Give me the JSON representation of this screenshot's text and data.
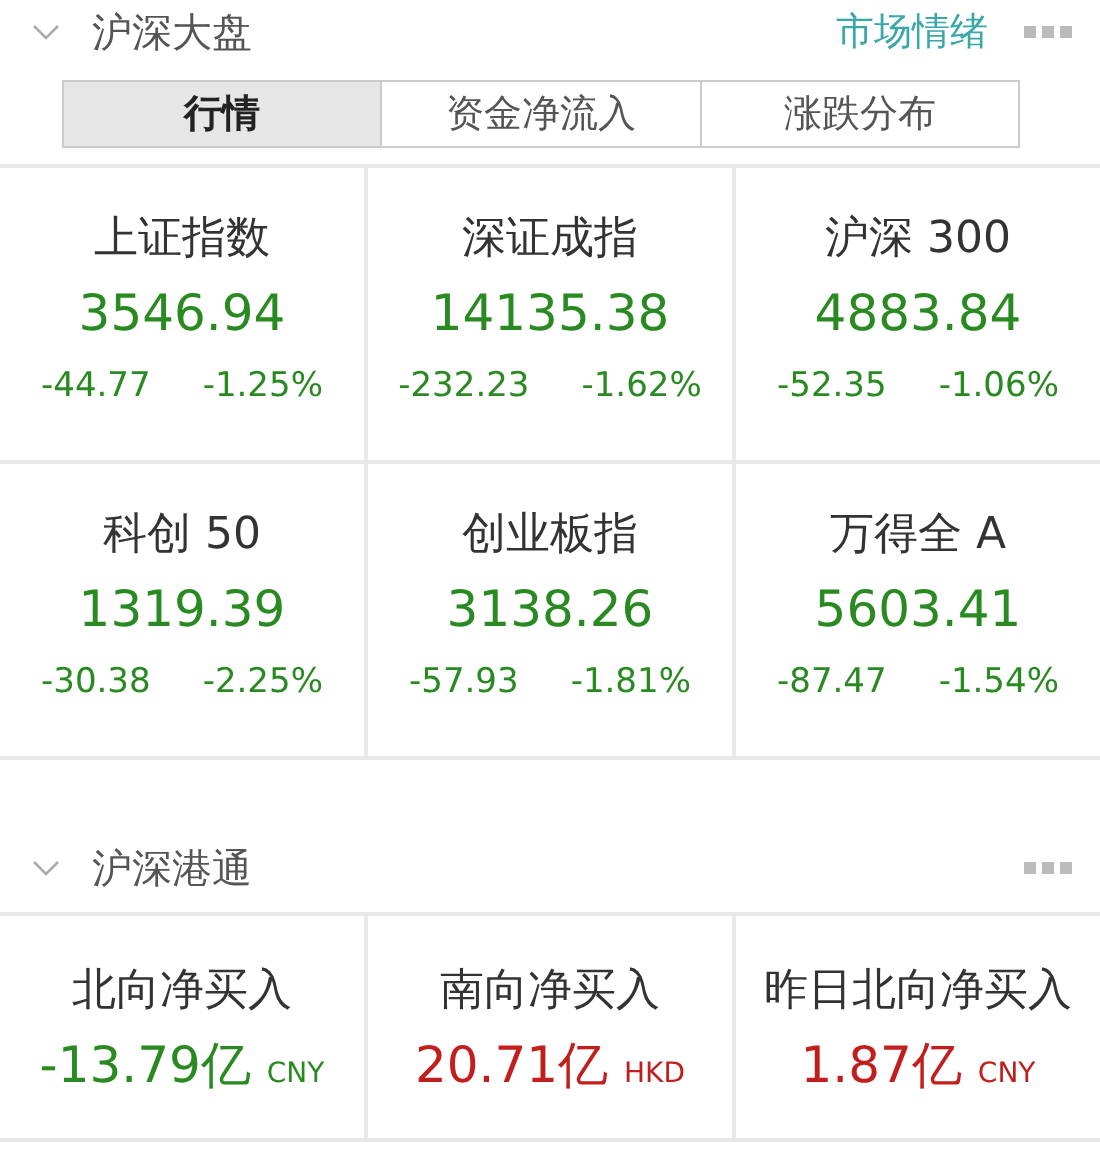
{
  "market": {
    "title": "沪深大盘",
    "link": "市场情绪",
    "tabs": [
      {
        "label": "行情",
        "selected": true
      },
      {
        "label": "资金净流入",
        "selected": false
      },
      {
        "label": "涨跌分布",
        "selected": false
      }
    ],
    "indices": [
      {
        "name": "上证指数",
        "value": "3546.94",
        "change": "-44.77",
        "percent": "-1.25%",
        "color": "#2a8a22"
      },
      {
        "name": "深证成指",
        "value": "14135.38",
        "change": "-232.23",
        "percent": "-1.62%",
        "color": "#2a8a22"
      },
      {
        "name": "沪深 300",
        "value": "4883.84",
        "change": "-52.35",
        "percent": "-1.06%",
        "color": "#2a8a22"
      },
      {
        "name": "科创 50",
        "value": "1319.39",
        "change": "-30.38",
        "percent": "-2.25%",
        "color": "#2a8a22"
      },
      {
        "name": "创业板指",
        "value": "3138.26",
        "change": "-57.93",
        "percent": "-1.81%",
        "color": "#2a8a22"
      },
      {
        "name": "万得全 A",
        "value": "5603.41",
        "change": "-87.47",
        "percent": "-1.54%",
        "color": "#2a8a22"
      }
    ]
  },
  "connect": {
    "title": "沪深港通",
    "flows": [
      {
        "name": "北向净买入",
        "value": "-13.79亿",
        "currency": "CNY",
        "color": "#2a8a22"
      },
      {
        "name": "南向净买入",
        "value": "20.71亿",
        "currency": "HKD",
        "color": "#c21f1c"
      },
      {
        "name": "昨日北向净买入",
        "value": "1.87亿",
        "currency": "CNY",
        "color": "#c21f1c"
      }
    ]
  }
}
